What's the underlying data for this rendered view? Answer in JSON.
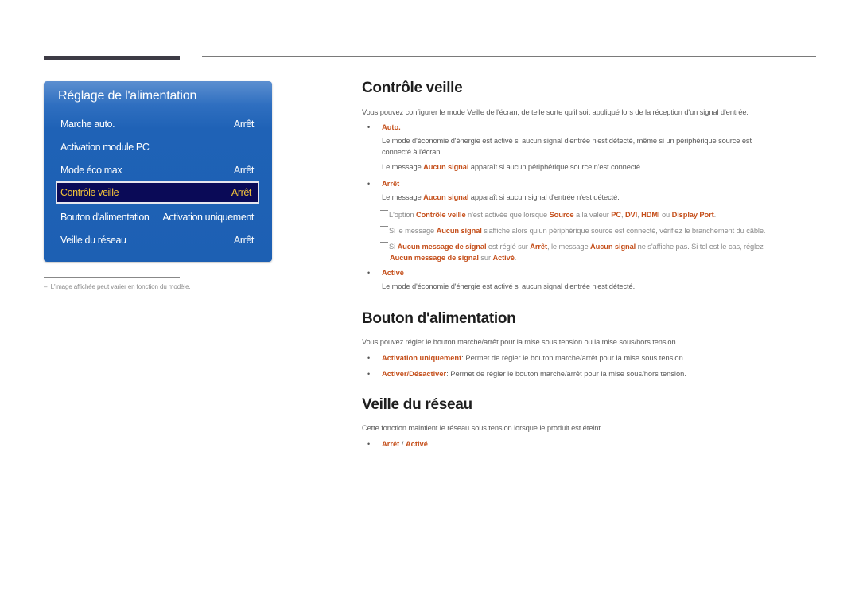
{
  "osd_panel": {
    "title": "Réglage de l'alimentation",
    "items": [
      {
        "label": "Marche auto.",
        "value": "Arrêt"
      },
      {
        "label": "Activation module PC",
        "value": ""
      },
      {
        "label": "Mode éco max",
        "value": "Arrêt"
      },
      {
        "label": "Contrôle veille",
        "value": "Arrêt",
        "selected": true
      },
      {
        "label": "Bouton d'alimentation",
        "value": "Activation uniquement"
      },
      {
        "label": "Veille du réseau",
        "value": "Arrêt"
      }
    ]
  },
  "footnote": "L'image affichée peut varier en fonction du modèle.",
  "sections": {
    "controle_veille": {
      "title": "Contrôle veille",
      "intro": "Vous pouvez configurer le mode Veille de l'écran, de telle sorte qu'il soit appliqué lors de la réception d'un signal d'entrée.",
      "auto": {
        "label": "Auto.",
        "desc_line1": "Le mode d'économie d'énergie est activé si aucun signal d'entrée n'est détecté, même si un périphérique source est",
        "desc_line2": "connecté à l'écran.",
        "msg_pre": "Le message ",
        "msg_hl": "Aucun signal",
        "msg_post": " apparaît si aucun périphérique source n'est connecté."
      },
      "arret": {
        "label": "Arrêt",
        "msg_pre": "Le message ",
        "msg_hl": "Aucun signal",
        "msg_post": " apparaît si aucun signal d'entrée n'est détecté.",
        "note1": {
          "t1": "L'option ",
          "h1": "Contrôle veille",
          "t2": " n'est activée que lorsque ",
          "h2": "Source",
          "t3": " a la valeur ",
          "h3": "PC",
          "t4": ", ",
          "h4": "DVI",
          "t5": ", ",
          "h5": "HDMI",
          "t6": " ou ",
          "h6": "Display Port",
          "t7": "."
        },
        "note2": {
          "t1": "Si le message ",
          "h1": "Aucun signal",
          "t2": " s'affiche alors qu'un périphérique source est connecté, vérifiez le branchement du câble."
        },
        "note3": {
          "t1": "Si ",
          "h1": "Aucun message de signal",
          "t2": " est réglé sur ",
          "h2": "Arrêt",
          "t3": ", le message ",
          "h3": "Aucun signal",
          "t4": " ne s'affiche pas. Si tel est le cas, réglez",
          "h4": "Aucun message de signal",
          "t5": " sur ",
          "h5": "Activé",
          "t6": "."
        }
      },
      "active": {
        "label": "Activé",
        "desc": "Le mode d'économie d'énergie est activé si aucun signal d'entrée n'est détecté."
      }
    },
    "bouton_alimentation": {
      "title": "Bouton d'alimentation",
      "intro": "Vous pouvez régler le bouton marche/arrêt pour la mise sous tension ou la mise sous/hors tension.",
      "options": [
        {
          "label": "Activation uniquement",
          "desc": ": Permet de régler le bouton marche/arrêt pour la mise sous tension."
        },
        {
          "label": "Activer/Désactiver",
          "desc": ": Permet de régler le bouton marche/arrêt pour la mise sous/hors tension."
        }
      ]
    },
    "veille_reseau": {
      "title": "Veille du réseau",
      "intro": "Cette fonction maintient le réseau sous tension lorsque le produit est éteint.",
      "opt_a": "Arrêt",
      "sep": " / ",
      "opt_b": "Activé"
    }
  },
  "colors": {
    "accent": "#c5501c",
    "panel_blue": "#1f62b6",
    "selected_bg": "#0a0a57",
    "selected_text": "#f3c43a"
  }
}
